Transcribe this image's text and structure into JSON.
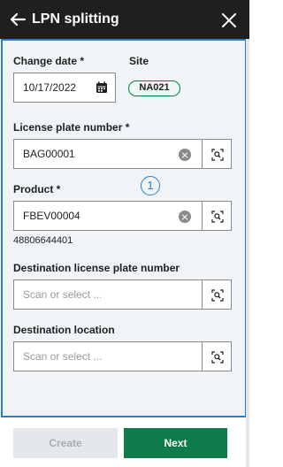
{
  "header": {
    "title": "LPN splitting"
  },
  "form": {
    "change_date": {
      "label": "Change date *",
      "value": "10/17/2022"
    },
    "site": {
      "label": "Site",
      "value": "NA021"
    },
    "license_plate_number": {
      "label": "License plate number *",
      "value": "BAG00001"
    },
    "product": {
      "label": "Product *",
      "value": "FBEV00004",
      "helper": "48806644401"
    },
    "destination_lpn": {
      "label": "Destination license plate number",
      "placeholder": "Scan or select ..."
    },
    "destination_location": {
      "label": "Destination location",
      "placeholder": "Scan or select ..."
    }
  },
  "marker": "1",
  "footer": {
    "create_label": "Create",
    "next_label": "Next"
  },
  "colors": {
    "header_bg": "#1f1f1f",
    "accent_green": "#0f7a4a",
    "focus_blue": "#2b7fc9",
    "panel_bg": "#f0f4f6"
  }
}
